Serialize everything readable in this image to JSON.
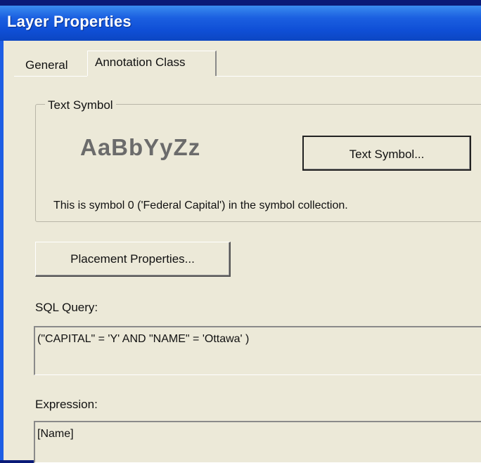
{
  "window": {
    "title": "Layer Properties"
  },
  "tabs": [
    {
      "label": "General",
      "selected": false
    },
    {
      "label": "Annotation Class",
      "selected": true
    }
  ],
  "text_symbol_group": {
    "legend": "Text Symbol",
    "sample": "AaBbYyZz",
    "button_label": "Text Symbol...",
    "info": "This is symbol 0 ('Federal Capital') in the symbol collection."
  },
  "placement_button_label": "Placement Properties...",
  "sql": {
    "label": "SQL Query:",
    "value": "(\"CAPITAL\" = 'Y' AND \"NAME\" = 'Ottawa' )"
  },
  "expression": {
    "label": "Expression:",
    "value": "[Name]"
  },
  "colors": {
    "titlebar": "#0f4fd6",
    "dialog_bg": "#ece9d8",
    "desktop": "#0a1a78"
  }
}
